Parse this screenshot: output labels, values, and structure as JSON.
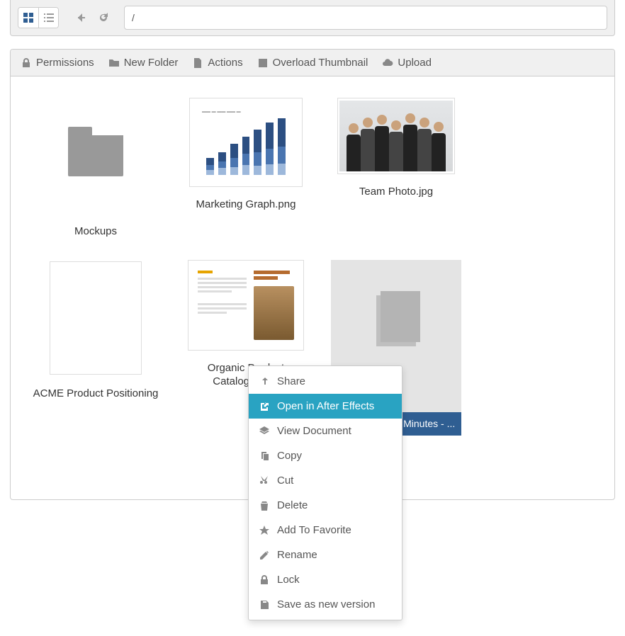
{
  "path_value": "/",
  "toolbar": {
    "permissions": "Permissions",
    "new_folder": "New Folder",
    "actions": "Actions",
    "overload_thumbnail": "Overload Thumbnail",
    "upload": "Upload"
  },
  "files": {
    "mockups": "Mockups",
    "marketing_graph": "Marketing Graph.png",
    "team_photo": "Team Photo.jpg",
    "acme": "ACME Product Positioning",
    "catalogue": "Organic Product Catalogue.pdf",
    "exo_caption": "eXo Platform - Minutes - ..."
  },
  "context_menu": {
    "share": "Share",
    "open_ae": "Open in After Effects",
    "view_doc": "View Document",
    "copy": "Copy",
    "cut": "Cut",
    "delete": "Delete",
    "favorite": "Add To Favorite",
    "rename": "Rename",
    "lock": "Lock",
    "save_version": "Save as new version"
  }
}
